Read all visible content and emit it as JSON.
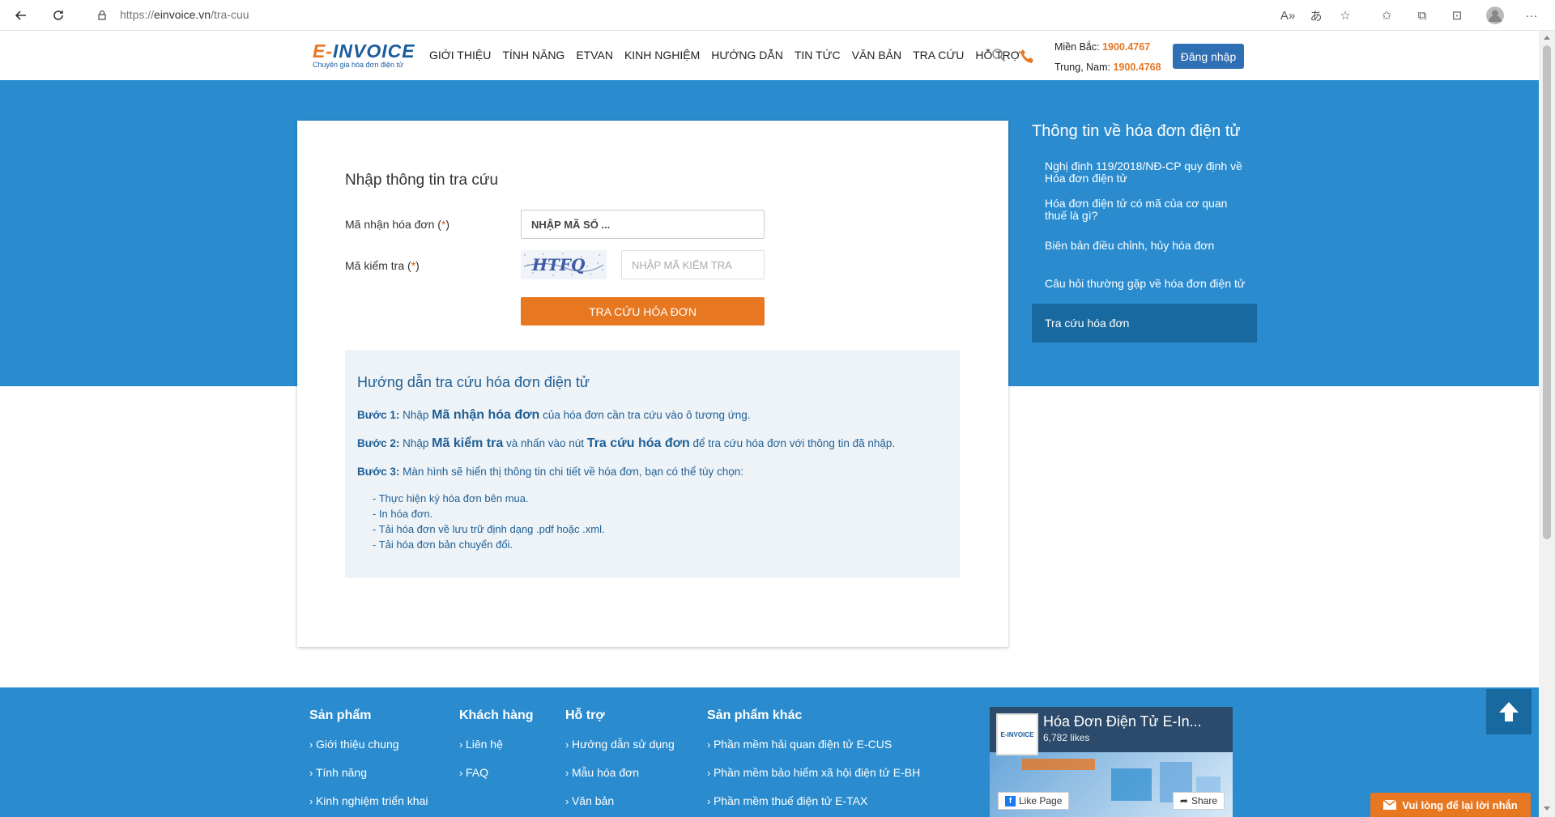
{
  "browser": {
    "url_scheme": "https://",
    "url_host": "einvoice.vn",
    "url_path": "/tra-cuu"
  },
  "header": {
    "logo_text_e": "E-",
    "logo_text": "INVOICE",
    "logo_tagline": "Chuyên gia hóa đơn điện tử",
    "nav": [
      "GIỚI THIỆU",
      "TÍNH NĂNG",
      "ETVAN",
      "KINH NGHIỆM",
      "HƯỚNG DẪN",
      "TIN TỨC",
      "VĂN BẢN",
      "TRA CỨU",
      "HỖ TRỢ"
    ],
    "hotline_north_label": "Miền Bắc:",
    "hotline_north": "1900.4767",
    "hotline_south_label": "Trung, Nam:",
    "hotline_south": "1900.4768",
    "login_label": "Đăng nhập"
  },
  "form": {
    "title": "Nhập thông tin tra cứu",
    "invoice_code_label": "Mã nhận hóa đơn (",
    "invoice_code_req": "*",
    "invoice_code_close": ")",
    "invoice_code_placeholder": "NHẬP MÃ SỐ ...",
    "check_code_label": "Mã kiểm tra (",
    "check_code_req": "*",
    "check_code_close": ")",
    "captcha_text": "HTFQ",
    "check_code_placeholder": "NHẬP MÃ KIỂM TRA",
    "submit_label": "TRA CỨU HÓA ĐƠN"
  },
  "guide": {
    "title": "Hướng dẫn tra cứu hóa đơn điện tử",
    "step1_label": "Bước 1:",
    "step1_pre": " Nhập ",
    "step1_bold": "Mã nhận hóa đơn",
    "step1_post": " của hóa đơn cần tra cứu vào ô tương ứng.",
    "step2_label": "Bước 2:",
    "step2_pre": " Nhập ",
    "step2_bold1": "Mã kiểm tra",
    "step2_mid": " và nhấn vào nút ",
    "step2_bold2": "Tra cứu hóa đơn",
    "step2_post": " để tra cứu hóa đơn với thông tin đã nhập.",
    "step3_label": "Bước 3:",
    "step3_text": " Màn hình sẽ hiển thị thông tin chi tiết về hóa đơn, bạn có thể tùy chọn:",
    "options": [
      "- Thực hiện ký hóa đơn bên mua.",
      "- In hóa đơn.",
      "- Tải hóa đơn về lưu trữ định dạng .pdf hoặc .xml.",
      "- Tải hóa đơn bản chuyển đổi."
    ]
  },
  "sidebar": {
    "title": "Thông tin về hóa đơn điện tử",
    "items": [
      "Nghị định 119/2018/NĐ-CP quy định về Hóa đơn điện tử",
      "Hóa đơn điện tử có mã của cơ quan thuế là gì?",
      "Biên bản điều chỉnh, hủy hóa đơn",
      "Câu hỏi thường gặp về hóa đơn điện tử",
      "Tra cứu hóa đơn"
    ]
  },
  "footer": {
    "col1_title": "Sản phẩm",
    "col1_items": [
      "Giới thiệu chung",
      "Tính năng",
      "Kinh nghiệm triển khai"
    ],
    "col2_title": "Khách hàng",
    "col2_items": [
      "Liên hệ",
      "FAQ"
    ],
    "col3_title": "Hỗ trợ",
    "col3_items": [
      "Hướng dẫn sử dụng",
      "Mẫu hóa đơn",
      "Văn bản"
    ],
    "col4_title": "Sản phẩm khác",
    "col4_items": [
      "Phần mềm hải quan điện tử E-CUS",
      "Phần mềm bảo hiểm xã hội điện tử E-BH",
      "Phần mềm thuế điện tử E-TAX"
    ],
    "fb_page_name": "Hóa Đơn Điện Tử E-In...",
    "fb_likes": "6,782 likes",
    "fb_like_label": "Like Page",
    "fb_share_label": "Share",
    "chat_label": "Vui lòng để lại lời nhắn"
  },
  "colors": {
    "brand_blue": "#2a8ccf",
    "accent_orange": "#e87722",
    "active_blue": "#18699f"
  }
}
